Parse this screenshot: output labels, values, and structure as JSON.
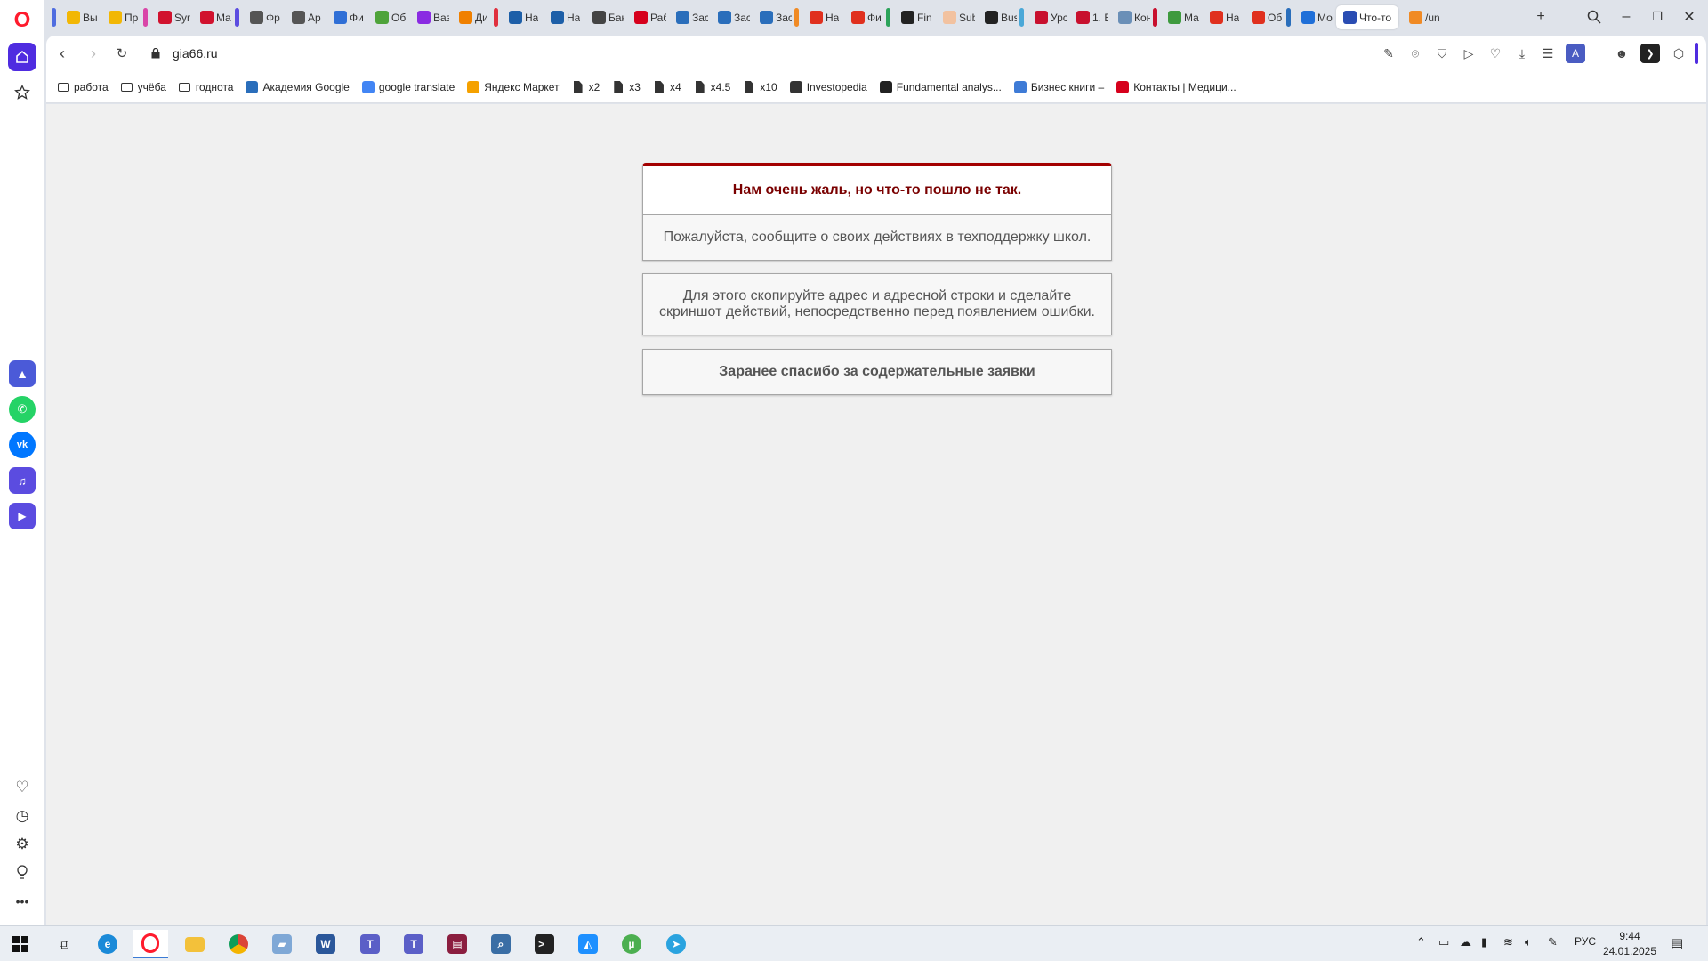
{
  "browser": {
    "tabs": [
      {
        "title": "Вы",
        "icon": "star-icon",
        "color": "#f2b705"
      },
      {
        "title": "Пр",
        "icon": "star-icon",
        "color": "#f2b705"
      },
      {
        "title": "Syn",
        "icon": "lms-icon",
        "color": "#d1122e"
      },
      {
        "title": "Ma",
        "icon": "lms-icon",
        "color": "#d1122e"
      },
      {
        "title": "Фр",
        "icon": "frame-icon",
        "color": "#555555"
      },
      {
        "title": "Ар",
        "icon": "frame-icon",
        "color": "#555555"
      },
      {
        "title": "Фи",
        "icon": "pen-icon",
        "color": "#2f6fd6"
      },
      {
        "title": "Об",
        "icon": "leaf-icon",
        "color": "#4ea33a"
      },
      {
        "title": "Ваз",
        "icon": "k-icon",
        "color": "#8a2be2"
      },
      {
        "title": "Ди",
        "icon": "sun-icon",
        "color": "#f08000"
      },
      {
        "title": "На",
        "icon": "news-icon",
        "color": "#1d5fa8"
      },
      {
        "title": "На",
        "icon": "news-icon",
        "color": "#1d5fa8"
      },
      {
        "title": "Бак",
        "icon": "globe-icon",
        "color": "#444444"
      },
      {
        "title": "Раб",
        "icon": "hh-icon",
        "color": "#d6001c"
      },
      {
        "title": "Зас",
        "icon": "bank-icon",
        "color": "#2a6ebb"
      },
      {
        "title": "Зас",
        "icon": "bank-icon",
        "color": "#2a6ebb"
      },
      {
        "title": "Зас",
        "icon": "bank-icon",
        "color": "#2a6ebb"
      },
      {
        "title": "На",
        "icon": "yandex-icon",
        "color": "#e0301e"
      },
      {
        "title": "Фи",
        "icon": "yandex-icon",
        "color": "#e0301e"
      },
      {
        "title": "Fin",
        "icon": "wiki-icon",
        "color": "#222222"
      },
      {
        "title": "Sub",
        "icon": "ft-icon",
        "color": "#f2c2a0"
      },
      {
        "title": "Bus",
        "icon": "wiki-icon",
        "color": "#222222"
      },
      {
        "title": "Урс",
        "icon": "square-red-icon",
        "color": "#c8102e"
      },
      {
        "title": "1. Е",
        "icon": "square-red-icon",
        "color": "#c8102e"
      },
      {
        "title": "Кон",
        "icon": "doc-icon",
        "color": "#6a8fb7"
      },
      {
        "title": "Ма",
        "icon": "book-icon",
        "color": "#3e9a3e"
      },
      {
        "title": "На",
        "icon": "yandex-icon",
        "color": "#e0301e"
      },
      {
        "title": "Об",
        "icon": "yandex-icon",
        "color": "#e0301e"
      },
      {
        "title": "Мо",
        "icon": "pause-icon",
        "color": "#1f6fd8"
      },
      {
        "title": "Что-то",
        "icon": "gia-icon",
        "color": "#2a4db3",
        "active": true
      },
      {
        "title": "/un",
        "icon": "bolt-icon",
        "color": "#f08a24"
      }
    ],
    "url": "gia66.ru",
    "bookmarks": [
      {
        "label": "работа",
        "icon": "folder-icon"
      },
      {
        "label": "учёба",
        "icon": "folder-icon"
      },
      {
        "label": "годнота",
        "icon": "folder-icon"
      },
      {
        "label": "Академия Google",
        "icon": "google-academy-icon"
      },
      {
        "label": "google translate",
        "icon": "translate-icon"
      },
      {
        "label": "Яндекс Маркет",
        "icon": "market-icon"
      },
      {
        "label": "x2",
        "icon": "file-icon"
      },
      {
        "label": "x3",
        "icon": "file-icon"
      },
      {
        "label": "x4",
        "icon": "file-icon"
      },
      {
        "label": "x4.5",
        "icon": "file-icon"
      },
      {
        "label": "x10",
        "icon": "file-icon"
      },
      {
        "label": "Investopedia",
        "icon": "investopedia-icon"
      },
      {
        "label": "Fundamental analys...",
        "icon": "wiki-icon"
      },
      {
        "label": "Бизнес книги –",
        "icon": "book-icon"
      },
      {
        "label": "Контакты | Медици...",
        "icon": "cross-icon"
      }
    ],
    "profile_letter": "A"
  },
  "page": {
    "error_title": "Нам очень жаль, но что-то пошло не так.",
    "report_text": "Пожалуйста, сообщите о своих действиях в техподдержку школ.",
    "instruction_line1": "Для этого скопируйте адрес и адресной строки и сделайте",
    "instruction_line2": "скриншот действий, непосредственно перед появлением ошибки.",
    "thanks_text": "Заранее спасибо за содержательные заявки"
  },
  "taskbar": {
    "language": "РУС",
    "time": "9:44",
    "date": "24.01.2025"
  },
  "colors": {
    "error_accent": "#a30000",
    "error_title": "#7a0000",
    "opera_red": "#ff1b2d",
    "sidebar_home": "#4f2ce0"
  }
}
